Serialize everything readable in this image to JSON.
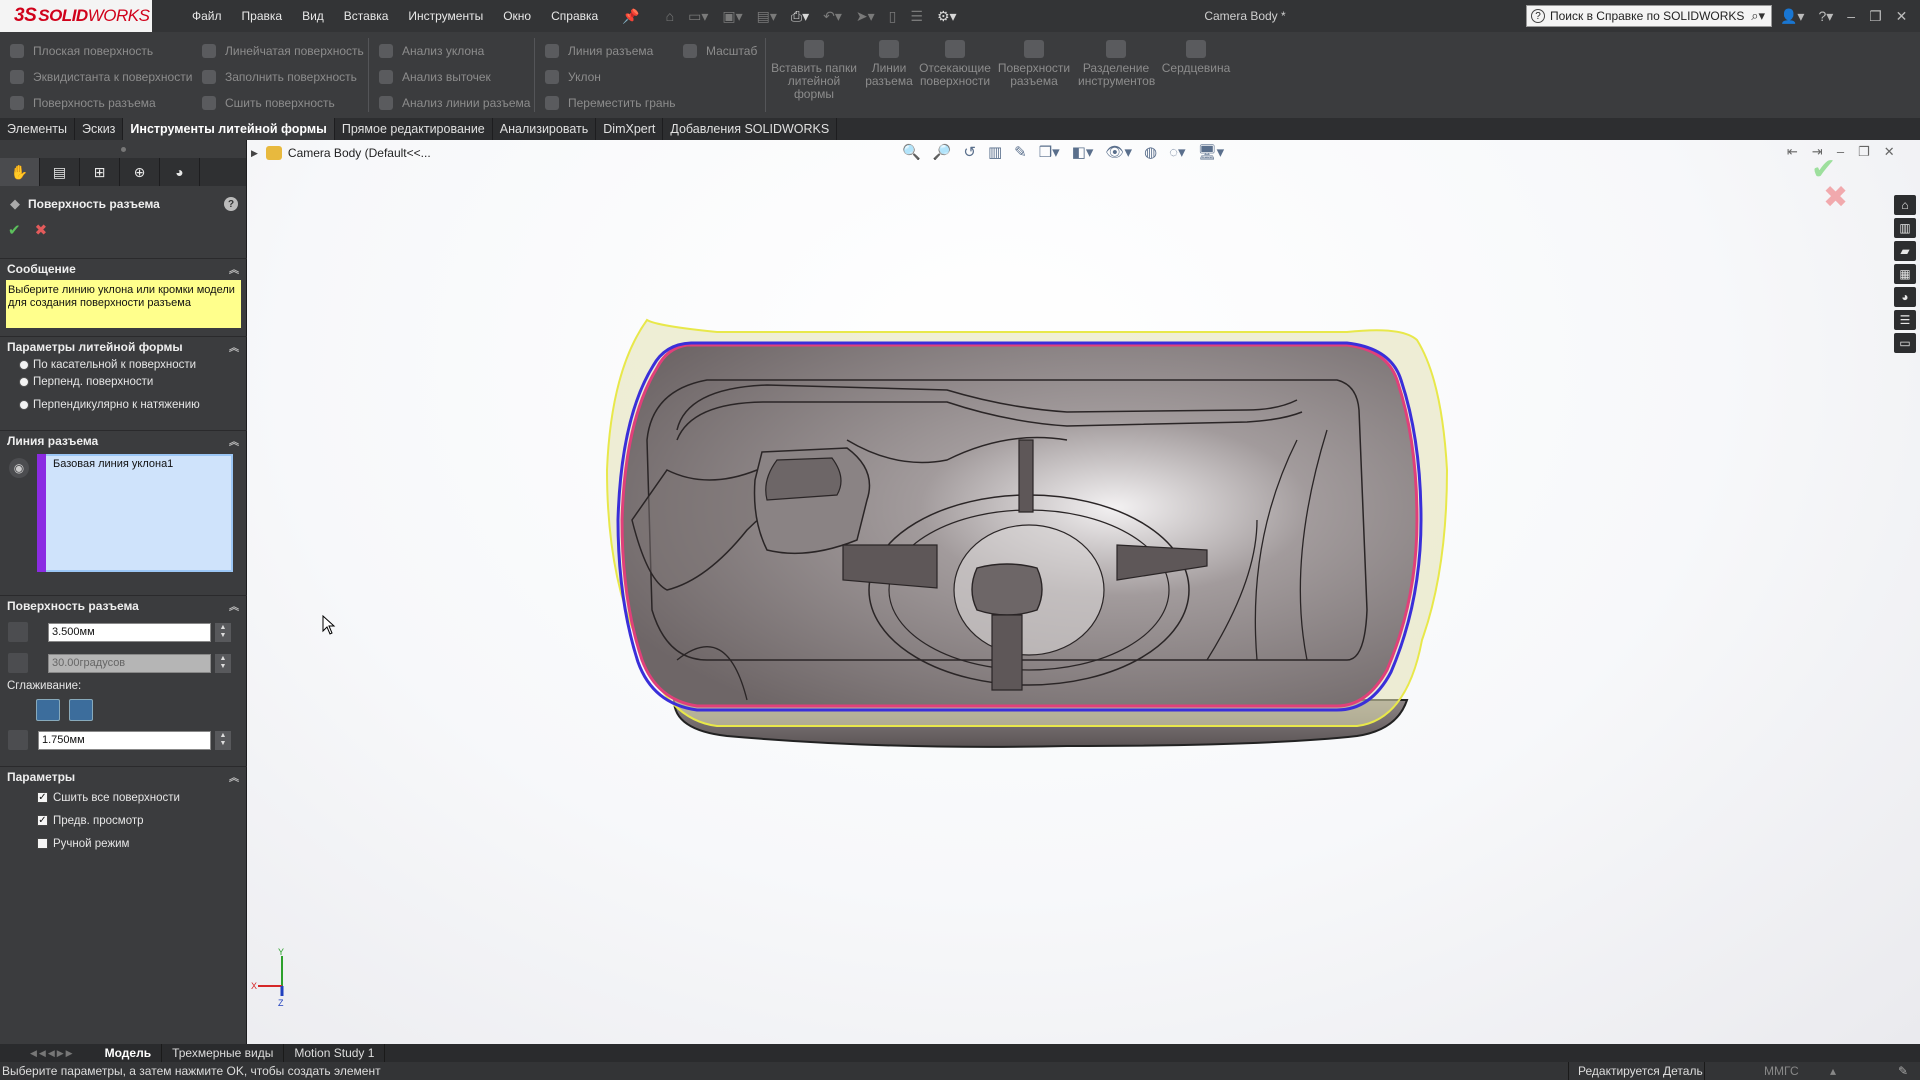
{
  "app": {
    "logo_ds": "3S",
    "logo_solid": "SOLID",
    "logo_works": "WORKS",
    "document_title": "Camera Body *",
    "menu": [
      "Файл",
      "Правка",
      "Вид",
      "Вставка",
      "Инструменты",
      "Окно",
      "Справка"
    ],
    "search_placeholder": "Поиск в Справке по SOLIDWORKS"
  },
  "command_manager": {
    "col1": [
      "Плоская поверхность",
      "Эквидистанта к поверхности",
      "Поверхность разъема"
    ],
    "col2": [
      "Линейчатая поверхность",
      "Заполнить поверхность",
      "Сшить поверхность"
    ],
    "col3": [
      "Анализ уклона",
      "Анализ выточек",
      "Анализ линии разъема"
    ],
    "col4": [
      "Линия разъема",
      "Уклон",
      "Переместить грань"
    ],
    "scale_label": "Масштаб",
    "big": [
      "Вставить папки литейной формы",
      "Линии разъема",
      "Отсекающие поверхности",
      "Поверхности разъема",
      "Разделение инструментов",
      "Сердцевина"
    ]
  },
  "tabs": [
    "Элементы",
    "Эскиз",
    "Инструменты литейной формы",
    "Прямое редактирование",
    "Анализировать",
    "DimXpert",
    "Добавления SOLIDWORKS"
  ],
  "active_tab": "Инструменты литейной формы",
  "tree": {
    "part_label": "Camera Body  (Default<<..."
  },
  "property_manager": {
    "title": "Поверхность разъема",
    "message_group": "Сообщение",
    "message_text": "Выберите линию уклона или кромки модели для создания поверхности разъема",
    "mold_params_group": "Параметры литейной формы",
    "mold_options": [
      "По касательной к поверхности",
      "Перпенд. поверхности",
      "Перпендикулярно к натяжению"
    ],
    "parting_line_group": "Линия разъема",
    "parting_line_item": "Базовая линия уклона1",
    "parting_surface_group": "Поверхность разъема",
    "distance_value": "3.500мм",
    "angle_value": "30.00градусов",
    "smoothing_label": "Сглаживание:",
    "smoothing_value": "1.750мм",
    "options_group": "Параметры",
    "options": [
      {
        "label": "Сшить все поверхности",
        "checked": true
      },
      {
        "label": "Предв. просмотр",
        "checked": true
      },
      {
        "label": "Ручной режим",
        "checked": false
      }
    ]
  },
  "triad": {
    "x": "X",
    "y": "Y",
    "z": "Z"
  },
  "bottom_tabs": [
    "Модель",
    "Трехмерные виды",
    "Motion Study 1"
  ],
  "active_bottom_tab": "Модель",
  "status": {
    "prompt": "Выберите параметры, а затем нажмите OK, чтобы создать элемент",
    "mode": "Редактируется Деталь",
    "units": "ММГС"
  },
  "colors": {
    "parting_line": "#3a2fd9",
    "parting_surface_edge": "#e8e84a",
    "highlight_edge": "#e0407a",
    "message_bg": "#ffff8c",
    "brand_red": "#d0021b"
  }
}
